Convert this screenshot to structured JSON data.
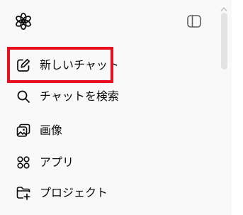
{
  "sidebar": {
    "logo_icon": "chatgpt-logo-icon",
    "toggle_icon": "sidebar-toggle-icon",
    "items": [
      {
        "label": "新しいチャット",
        "icon": "edit-pencil-icon"
      },
      {
        "label": "チャットを検索",
        "icon": "search-icon"
      },
      {
        "label": "画像",
        "icon": "images-icon"
      },
      {
        "label": "アプリ",
        "icon": "apps-grid-icon"
      },
      {
        "label": "プロジェクト",
        "icon": "folder-add-icon"
      }
    ]
  },
  "highlight": {
    "color": "#e8101f",
    "target": "新しいチャット"
  }
}
